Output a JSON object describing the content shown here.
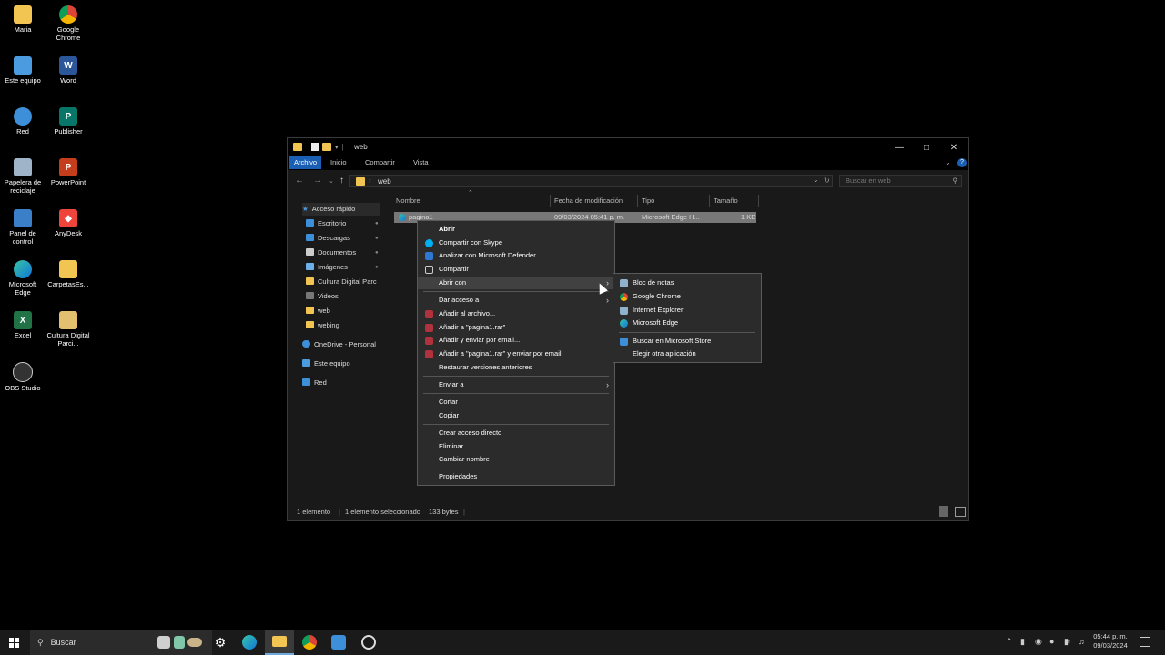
{
  "desktop": {
    "icons": [
      {
        "label": "Maria"
      },
      {
        "label": "Google Chrome"
      },
      {
        "label": "Este equipo"
      },
      {
        "label": "Word"
      },
      {
        "label": "Red"
      },
      {
        "label": "Publisher"
      },
      {
        "label": "Papelera de reciclaje"
      },
      {
        "label": "PowerPoint"
      },
      {
        "label": "Panel de control"
      },
      {
        "label": "AnyDesk"
      },
      {
        "label": "Microsoft Edge"
      },
      {
        "label": "CarpetasEs..."
      },
      {
        "label": "Excel"
      },
      {
        "label": "Cultura Digital Parci..."
      },
      {
        "label": "OBS Studio"
      }
    ]
  },
  "window": {
    "title": "web",
    "ribbon_tabs": [
      "Archivo",
      "Inicio",
      "Compartir",
      "Vista"
    ],
    "address": "web",
    "search_placeholder": "Buscar en web",
    "nav": [
      {
        "label": "Acceso rápido"
      },
      {
        "label": "Escritorio"
      },
      {
        "label": "Descargas"
      },
      {
        "label": "Documentos"
      },
      {
        "label": "Imágenes"
      },
      {
        "label": "Cultura Digital Parc"
      },
      {
        "label": "Videos"
      },
      {
        "label": "web"
      },
      {
        "label": "webing"
      },
      {
        "label": "OneDrive - Personal"
      },
      {
        "label": "Este equipo"
      },
      {
        "label": "Red"
      }
    ],
    "columns": [
      "Nombre",
      "Fecha de modificación",
      "Tipo",
      "Tamaño"
    ],
    "file": {
      "name": "pagina1",
      "date": "09/03/2024 05:41 p. m.",
      "type": "Microsoft Edge H...",
      "size": "1 KB"
    },
    "status": {
      "count": "1 elemento",
      "selected": "1 elemento seleccionado",
      "bytes": "133 bytes"
    }
  },
  "context_menu": {
    "items": [
      {
        "label": "Abrir"
      },
      {
        "label": "Compartir con Skype"
      },
      {
        "label": "Analizar con Microsoft Defender..."
      },
      {
        "label": "Compartir"
      },
      {
        "label": "Abrir con"
      },
      {
        "label": "Dar acceso a"
      },
      {
        "label": "Añadir al archivo..."
      },
      {
        "label": "Añadir a \"pagina1.rar\""
      },
      {
        "label": "Añadir y enviar por email..."
      },
      {
        "label": "Añadir a \"pagina1.rar\" y enviar por email"
      },
      {
        "label": "Restaurar versiones anteriores"
      },
      {
        "label": "Enviar a"
      },
      {
        "label": "Cortar"
      },
      {
        "label": "Copiar"
      },
      {
        "label": "Crear acceso directo"
      },
      {
        "label": "Eliminar"
      },
      {
        "label": "Cambiar nombre"
      },
      {
        "label": "Propiedades"
      }
    ]
  },
  "submenu": {
    "items": [
      {
        "label": "Bloc de notas"
      },
      {
        "label": "Google Chrome"
      },
      {
        "label": "Internet Explorer"
      },
      {
        "label": "Microsoft Edge"
      },
      {
        "label": "Buscar en Microsoft Store"
      },
      {
        "label": "Elegir otra aplicación"
      }
    ]
  },
  "taskbar": {
    "search_label": "Buscar",
    "time": "05:44 p. m.",
    "date": "09/03/2024"
  },
  "colors": {
    "accent": "#1a5fb4",
    "folder": "#f2c451",
    "menu_bg": "#2b2b2b"
  }
}
